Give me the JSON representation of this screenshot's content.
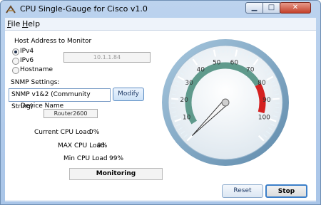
{
  "window": {
    "title": "CPU Single-Gauge for Cisco v1.0",
    "controls": {
      "minimize": "▁",
      "maximize": "□",
      "close": "✕"
    }
  },
  "menu": {
    "file": "File",
    "help": "Help"
  },
  "host": {
    "label": "Host Address to Monitor",
    "options": [
      "IPv4",
      "IPv6",
      "Hostname"
    ],
    "selected": "IPv4",
    "address": "10.1.1.84"
  },
  "snmp": {
    "label": "SNMP Settings:",
    "value": "SNMP v1&2 (Community String)",
    "modify_label": "Modify"
  },
  "device": {
    "label": "Device Name",
    "value": "Router2600"
  },
  "stats": {
    "current_label": "Current CPU Load",
    "current_value": "0%",
    "max_label": "MAX CPU Load",
    "max_value": "0%",
    "min_label": "Min CPU Load",
    "min_value": "99%"
  },
  "status": {
    "monitoring": "Monitoring"
  },
  "buttons": {
    "reset": "Reset",
    "stop": "Stop"
  },
  "gauge": {
    "min": 0,
    "max": 110,
    "major_ticks": [
      10,
      20,
      30,
      40,
      50,
      60,
      70,
      80,
      90,
      100
    ],
    "labels": [
      "10",
      "20",
      "30",
      "40",
      "50",
      "60",
      "70",
      "80",
      "90",
      "100"
    ],
    "needle_value": 0,
    "red_zone": [
      80,
      110
    ],
    "colors": {
      "red": "#d42020",
      "band": "#5f9a8c",
      "face": "#eef3f6",
      "rim": "#7ea6c4"
    }
  }
}
